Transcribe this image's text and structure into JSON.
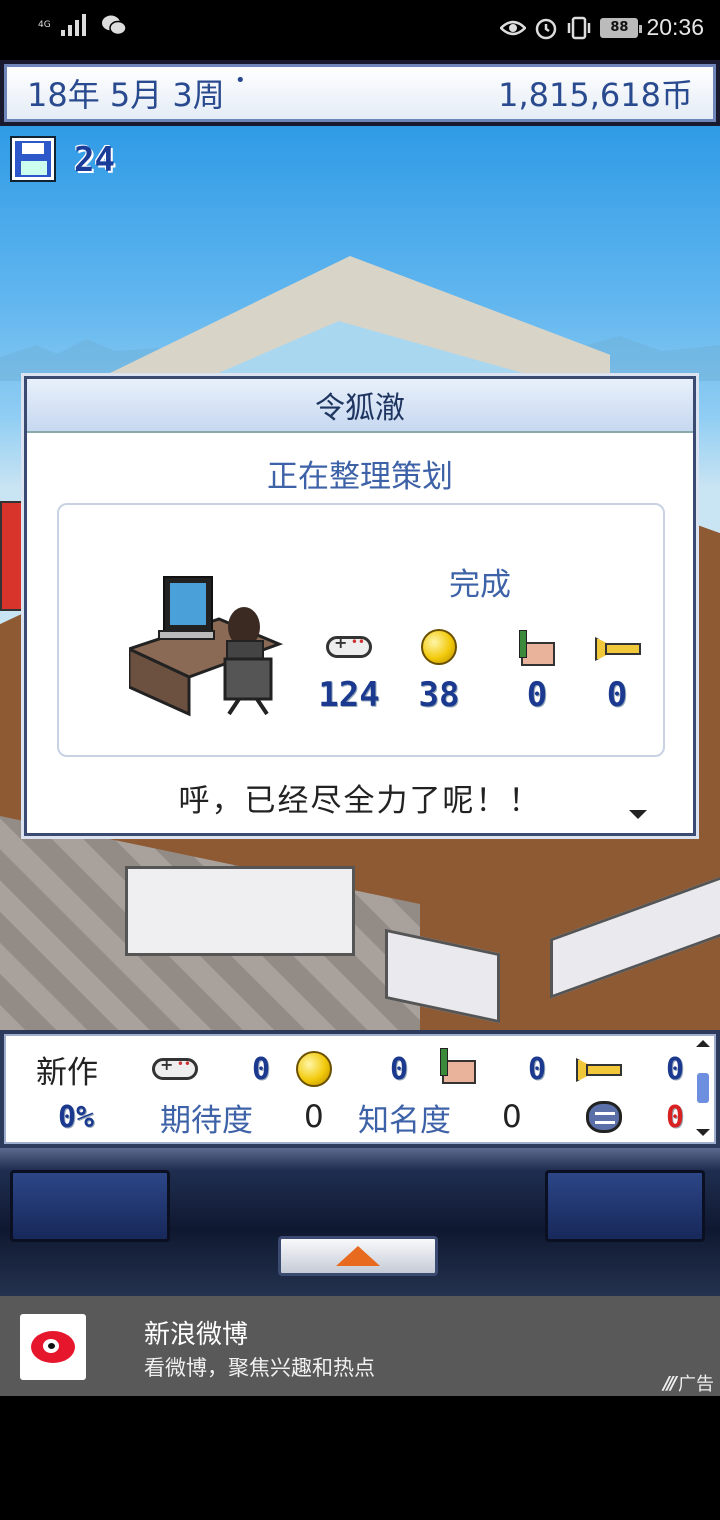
{
  "status_bar": {
    "network": "4G",
    "battery": "88",
    "time": "20:36"
  },
  "top_bar": {
    "date": "18年 5月 3周",
    "money": "1,815,618币"
  },
  "save": {
    "count": "24"
  },
  "dialog": {
    "name": "令狐澈",
    "status": "正在整理策划",
    "done_label": "完成",
    "stats": [
      {
        "icon": "gamepad-icon",
        "value": "124"
      },
      {
        "icon": "coin-icon",
        "value": "38"
      },
      {
        "icon": "brush-icon",
        "value": "0"
      },
      {
        "icon": "trumpet-icon",
        "value": "0"
      }
    ],
    "message": "呼，已经尽全力了呢！！"
  },
  "panel": {
    "new_label": "新作",
    "stats": [
      "0",
      "0",
      "0",
      "0"
    ],
    "progress": "0%",
    "expectation_label": "期待度",
    "expectation_value": "0",
    "fame_label": "知名度",
    "fame_value": "0",
    "bugs": "0"
  },
  "ad": {
    "title": "新浪微博",
    "description": "看微博，聚焦兴趣和热点",
    "tag": "广告"
  }
}
